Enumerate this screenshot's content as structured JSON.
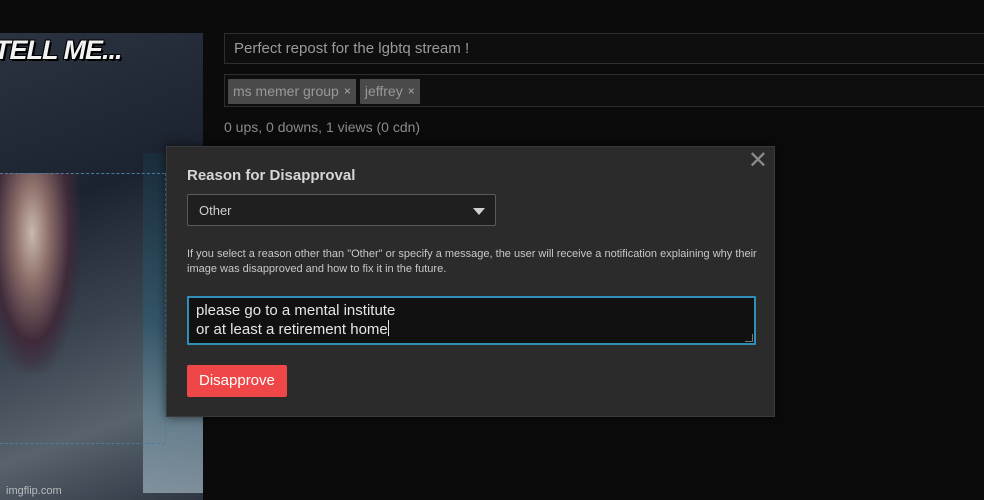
{
  "meme": {
    "caption": "TELL ME...",
    "watermark": "imgflip.com"
  },
  "post": {
    "title": "Perfect repost for the lgbtq stream  !",
    "tags": [
      {
        "label": "ms memer group",
        "remove": "×"
      },
      {
        "label": "jeffrey",
        "remove": "×"
      }
    ],
    "stats": "0 ups, 0 downs, 1 views (0 cdn)"
  },
  "modal": {
    "close": "✕",
    "title": "Reason for Disapproval",
    "reason_selected": "Other",
    "help_text": "If you select a reason other than \"Other\" or specify a message, the user will receive a notification explaining why their image was disapproved and how to fix it in the future.",
    "message_line1": "please go to a mental institute",
    "message_line2": "or at least a retirement home",
    "disapprove_label": "Disapprove"
  },
  "colors": {
    "accent_button": "#ef4747",
    "focus_border": "#2f8fb8",
    "modal_bg": "#2b2b2b"
  }
}
